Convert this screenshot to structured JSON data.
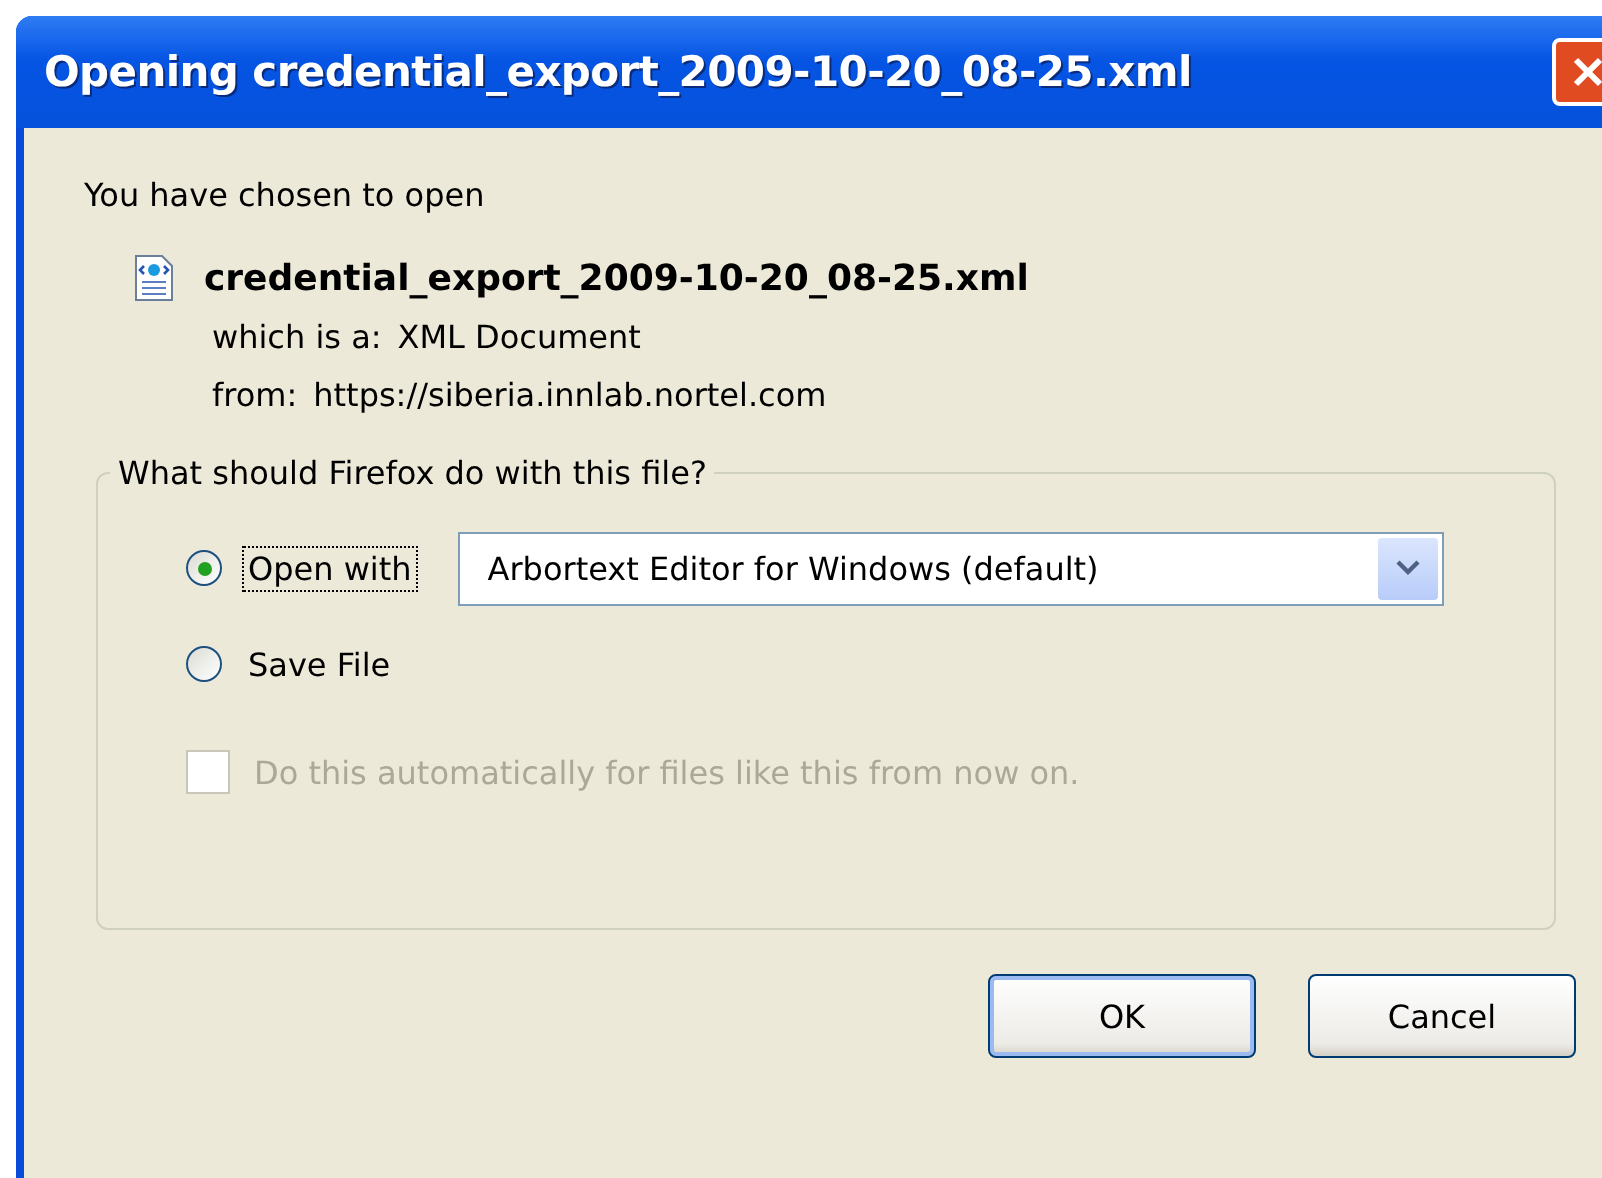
{
  "window": {
    "title": "Opening credential_export_2009-10-20_08-25.xml"
  },
  "intro": "You have chosen to open",
  "file": {
    "name": "credential_export_2009-10-20_08-25.xml",
    "type_label": "which is a:",
    "type": "XML Document",
    "from_label": "from:",
    "from": "https://siberia.innlab.nortel.com"
  },
  "group": {
    "legend": "What should Firefox do with this file?",
    "options": [
      {
        "kind": "radio",
        "label": "Open with",
        "selected": true,
        "focused": true,
        "app": "Arbortext Editor for Windows (default)"
      },
      {
        "kind": "radio",
        "label": "Save File",
        "selected": false,
        "focused": false
      }
    ],
    "auto": {
      "label": "Do this automatically for files like this from now on.",
      "checked": false,
      "disabled": true
    }
  },
  "buttons": [
    {
      "label": "OK",
      "default": true
    },
    {
      "label": "Cancel",
      "default": false
    }
  ]
}
